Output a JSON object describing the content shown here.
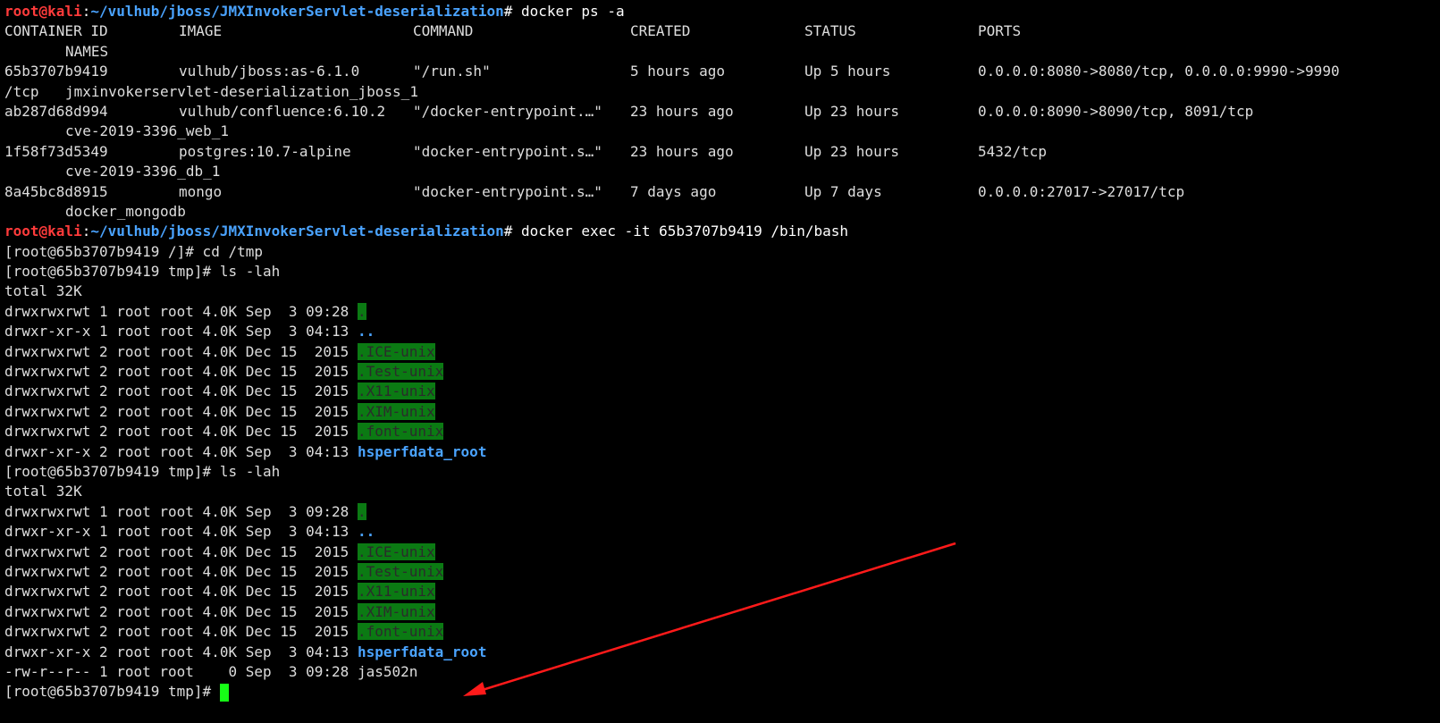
{
  "prompt": {
    "user": "root@kali",
    "sep": ":",
    "path": "~/vulhub/jboss/JMXInvokerServlet-deserialization",
    "sym": "#"
  },
  "cmd1": " docker ps -a",
  "headers": [
    "CONTAINER ID",
    "IMAGE",
    "COMMAND",
    "CREATED",
    "STATUS",
    "PORTS",
    "NAMES"
  ],
  "containers": [
    {
      "id": "65b3707b9419",
      "image": "vulhub/jboss:as-6.1.0",
      "command": "\"/run.sh\"",
      "created": "5 hours ago",
      "status": "Up 5 hours",
      "ports": "0.0.0.0:8080->8080/tcp, 0.0.0.0:9990->9990",
      "wrap": "/tcp",
      "name": "jmxinvokerservlet-deserialization_jboss_1"
    },
    {
      "id": "ab287d68d994",
      "image": "vulhub/confluence:6.10.2",
      "command": "\"/docker-entrypoint.…\"",
      "created": "23 hours ago",
      "status": "Up 23 hours",
      "ports": "0.0.0.0:8090->8090/tcp, 8091/tcp",
      "wrap": "",
      "name": "cve-2019-3396_web_1"
    },
    {
      "id": "1f58f73d5349",
      "image": "postgres:10.7-alpine",
      "command": "\"docker-entrypoint.s…\"",
      "created": "23 hours ago",
      "status": "Up 23 hours",
      "ports": "5432/tcp",
      "wrap": "",
      "name": "cve-2019-3396_db_1"
    },
    {
      "id": "8a45bc8d8915",
      "image": "mongo",
      "command": "\"docker-entrypoint.s…\"",
      "created": "7 days ago",
      "status": "Up 7 days",
      "ports": "0.0.0.0:27017->27017/tcp",
      "wrap": "",
      "name": "docker_mongodb"
    }
  ],
  "cmd2": " docker exec -it 65b3707b9419 /bin/bash",
  "shell_lines": {
    "cd": "[root@65b3707b9419 /]# cd /tmp",
    "ls1": "[root@65b3707b9419 tmp]# ls -lah",
    "ls2": "[root@65b3707b9419 tmp]# ls -lah",
    "final_prompt": "[root@65b3707b9419 tmp]#"
  },
  "listing1": {
    "total": "total 32K",
    "entries": [
      {
        "meta": "drwxrwxrwt 1 root root 4.0K Sep  3 09:28 ",
        "name": ".",
        "style": "hl"
      },
      {
        "meta": "drwxr-xr-x 1 root root 4.0K Sep  3 04:13 ",
        "name": "..",
        "style": "dir"
      },
      {
        "meta": "drwxrwxrwt 2 root root 4.0K Dec 15  2015 ",
        "name": ".ICE-unix",
        "style": "hl"
      },
      {
        "meta": "drwxrwxrwt 2 root root 4.0K Dec 15  2015 ",
        "name": ".Test-unix",
        "style": "hl"
      },
      {
        "meta": "drwxrwxrwt 2 root root 4.0K Dec 15  2015 ",
        "name": ".X11-unix",
        "style": "hl"
      },
      {
        "meta": "drwxrwxrwt 2 root root 4.0K Dec 15  2015 ",
        "name": ".XIM-unix",
        "style": "hl"
      },
      {
        "meta": "drwxrwxrwt 2 root root 4.0K Dec 15  2015 ",
        "name": ".font-unix",
        "style": "hl"
      },
      {
        "meta": "drwxr-xr-x 2 root root 4.0K Sep  3 04:13 ",
        "name": "hsperfdata_root",
        "style": "dir"
      }
    ]
  },
  "listing2": {
    "total": "total 32K",
    "entries": [
      {
        "meta": "drwxrwxrwt 1 root root 4.0K Sep  3 09:28 ",
        "name": ".",
        "style": "hl"
      },
      {
        "meta": "drwxr-xr-x 1 root root 4.0K Sep  3 04:13 ",
        "name": "..",
        "style": "dir"
      },
      {
        "meta": "drwxrwxrwt 2 root root 4.0K Dec 15  2015 ",
        "name": ".ICE-unix",
        "style": "hl"
      },
      {
        "meta": "drwxrwxrwt 2 root root 4.0K Dec 15  2015 ",
        "name": ".Test-unix",
        "style": "hl"
      },
      {
        "meta": "drwxrwxrwt 2 root root 4.0K Dec 15  2015 ",
        "name": ".X11-unix",
        "style": "hl"
      },
      {
        "meta": "drwxrwxrwt 2 root root 4.0K Dec 15  2015 ",
        "name": ".XIM-unix",
        "style": "hl"
      },
      {
        "meta": "drwxrwxrwt 2 root root 4.0K Dec 15  2015 ",
        "name": ".font-unix",
        "style": "hl"
      },
      {
        "meta": "drwxr-xr-x 2 root root 4.0K Sep  3 04:13 ",
        "name": "hsperfdata_root",
        "style": "dir"
      },
      {
        "meta": "-rw-r--r-- 1 root root    0 Sep  3 09:28 ",
        "name": "jas502n",
        "style": "plain"
      }
    ]
  },
  "colors": {
    "background": "#000000",
    "prompt_user": "#ff3b3b",
    "prompt_path": "#4aa3ff",
    "dir_highlight": "#0b7a13",
    "cursor": "#16ff16",
    "arrow": "#ff1a1a"
  },
  "icons": {
    "cursor": "block-cursor",
    "annotation": "red-arrow-annotation"
  }
}
